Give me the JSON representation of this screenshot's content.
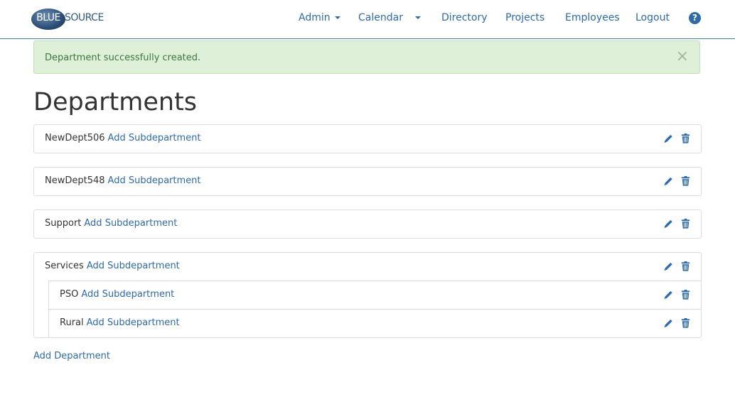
{
  "logo": {
    "part1": "BLUE",
    "part2": "SOURCE"
  },
  "nav": {
    "admin": "Admin",
    "calendar": "Calendar",
    "directory": "Directory",
    "projects": "Projects",
    "employees": "Employees",
    "logout": "Logout",
    "help": "?"
  },
  "alert": {
    "message": "Department successfully created.",
    "close": "×"
  },
  "page_title": "Departments",
  "add_subdepartment_label": "Add Subdepartment",
  "departments": [
    {
      "name": "NewDept506"
    },
    {
      "name": "NewDept548"
    },
    {
      "name": "Support"
    },
    {
      "name": "Services",
      "subdepartments": [
        {
          "name": "PSO"
        },
        {
          "name": "Rural"
        }
      ]
    }
  ],
  "add_department_label": "Add Department",
  "colors": {
    "link": "#2e6ba8",
    "alert_bg": "#dff0d8",
    "alert_text": "#3c763d",
    "border": "#dddddd"
  },
  "icons": {
    "edit": "pencil-icon",
    "delete": "trash-icon",
    "help": "question-icon"
  }
}
